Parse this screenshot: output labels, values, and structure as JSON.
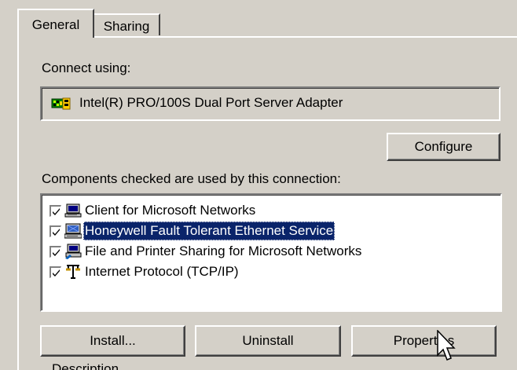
{
  "tabs": {
    "general": "General",
    "sharing": "Sharing"
  },
  "connect_using_label": "Connect using:",
  "adapter": {
    "name": "Intel(R) PRO/100S Dual Port Server Adapter",
    "icon": "network-adapter-icon"
  },
  "configure_button": "Configure",
  "components_label": "Components checked are used by this connection:",
  "components": [
    {
      "label": "Client for Microsoft Networks",
      "checked": true,
      "icon": "client-network-icon",
      "selected": false
    },
    {
      "label": "Honeywell Fault Tolerant Ethernet Service",
      "checked": true,
      "icon": "service-icon",
      "selected": true
    },
    {
      "label": "File and Printer Sharing for Microsoft Networks",
      "checked": true,
      "icon": "file-printer-sharing-icon",
      "selected": false
    },
    {
      "label": "Internet Protocol (TCP/IP)",
      "checked": true,
      "icon": "protocol-icon",
      "selected": false
    }
  ],
  "buttons": {
    "install": "Install...",
    "uninstall": "Uninstall",
    "properties": "Properties"
  },
  "description_partial": "Description",
  "colors": {
    "dialog_face": "#d4d0c8",
    "selection": "#0a246a",
    "list_background": "#ffffff"
  }
}
